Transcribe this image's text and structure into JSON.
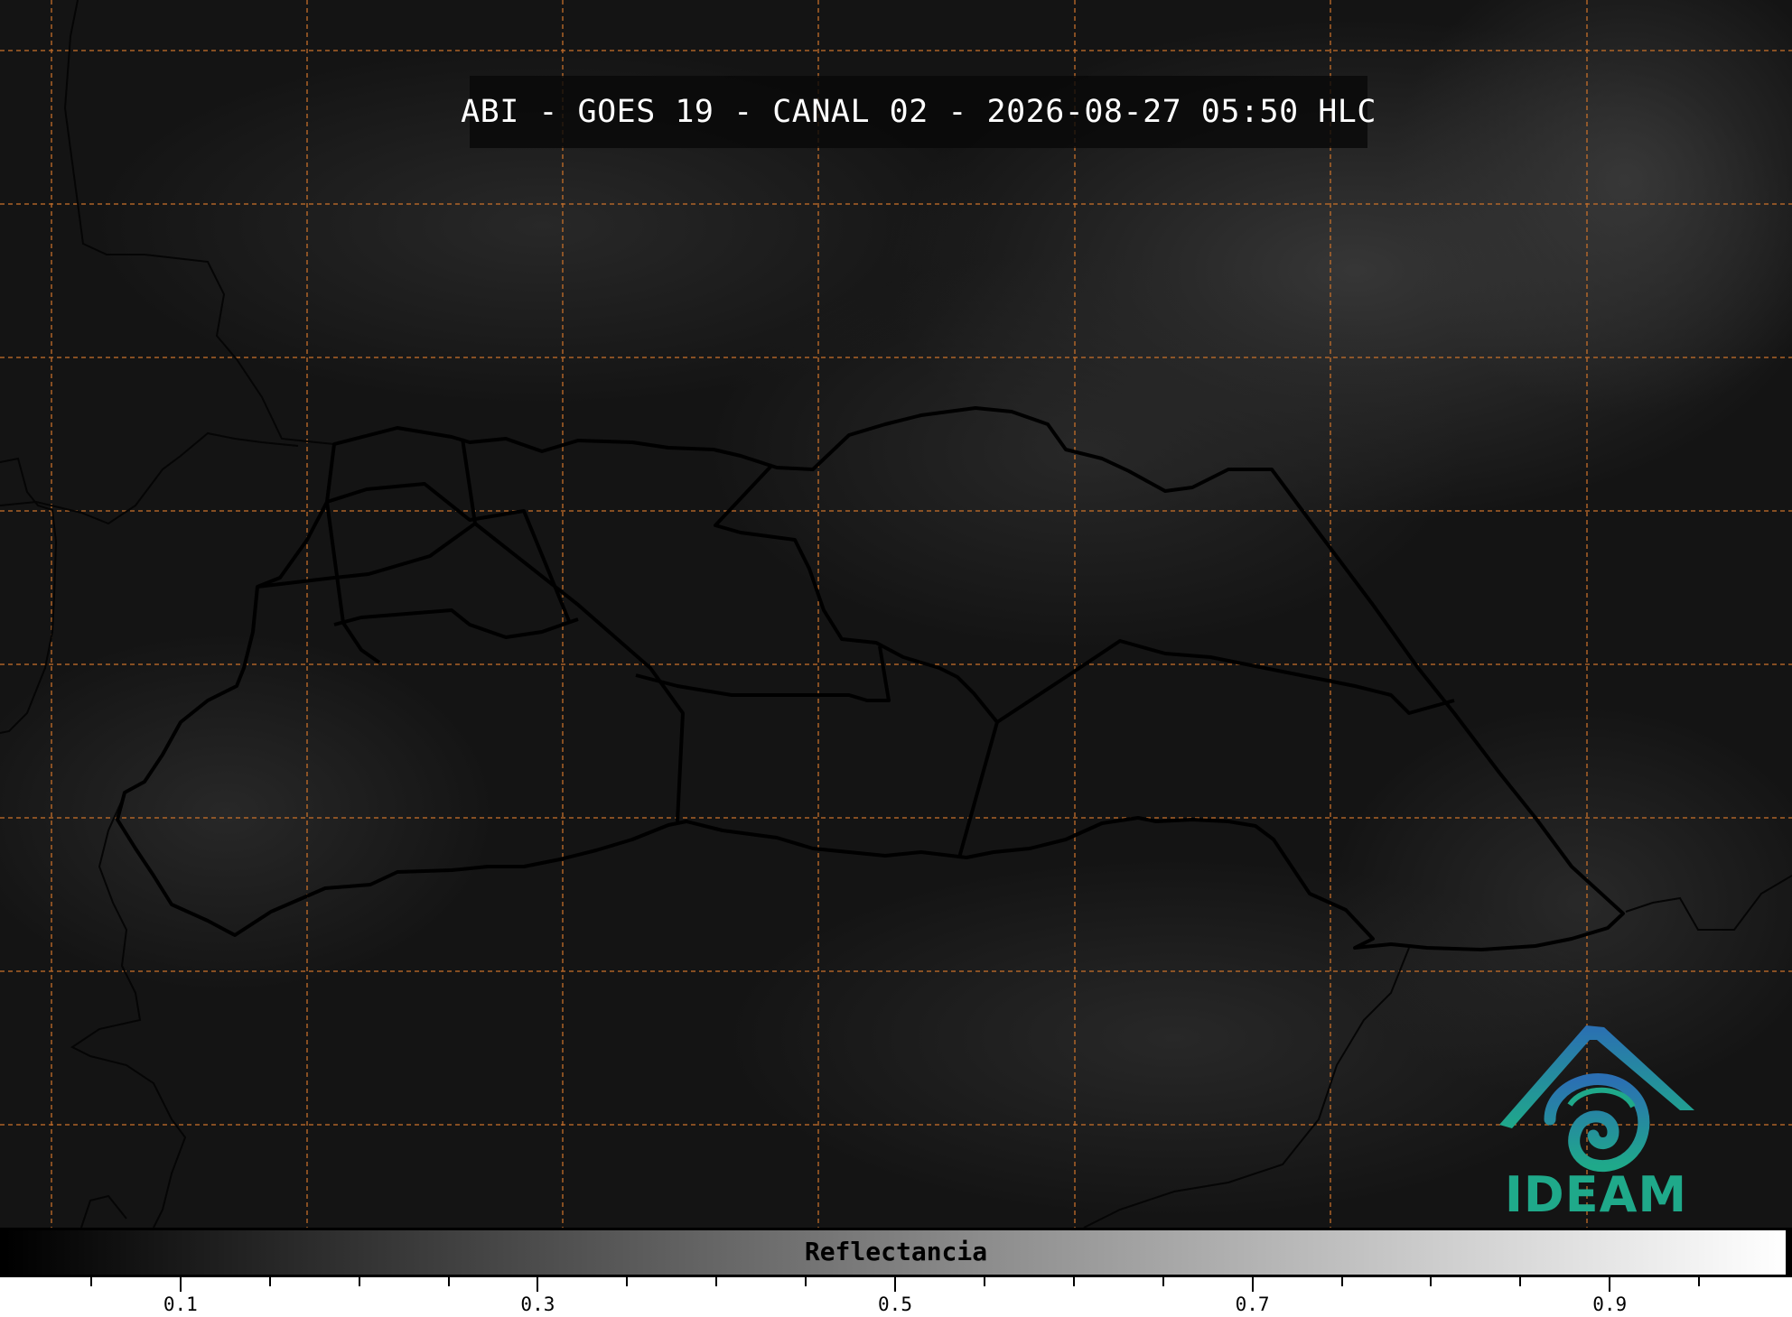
{
  "title": "ABI - GOES 19 - CANAL 02 - 2026-08-27 05:50 HLC",
  "logo": {
    "text": "IDEAM",
    "primary_color": "#1fa98a",
    "secondary_color": "#2b6fb3"
  },
  "colorbar": {
    "label": "Reflectancia",
    "range": [
      0.0,
      1.0
    ],
    "major_ticks": [
      0.1,
      0.3,
      0.5,
      0.7,
      0.9
    ],
    "major_labels": [
      "0.1",
      "0.3",
      "0.5",
      "0.7",
      "0.9"
    ],
    "minor_step": 0.05,
    "colors": [
      "#000000",
      "#ffffff"
    ]
  },
  "map": {
    "background": "#141414",
    "gridline_color": "#c8702a",
    "border_color": "#000000",
    "gridlines": "on"
  }
}
